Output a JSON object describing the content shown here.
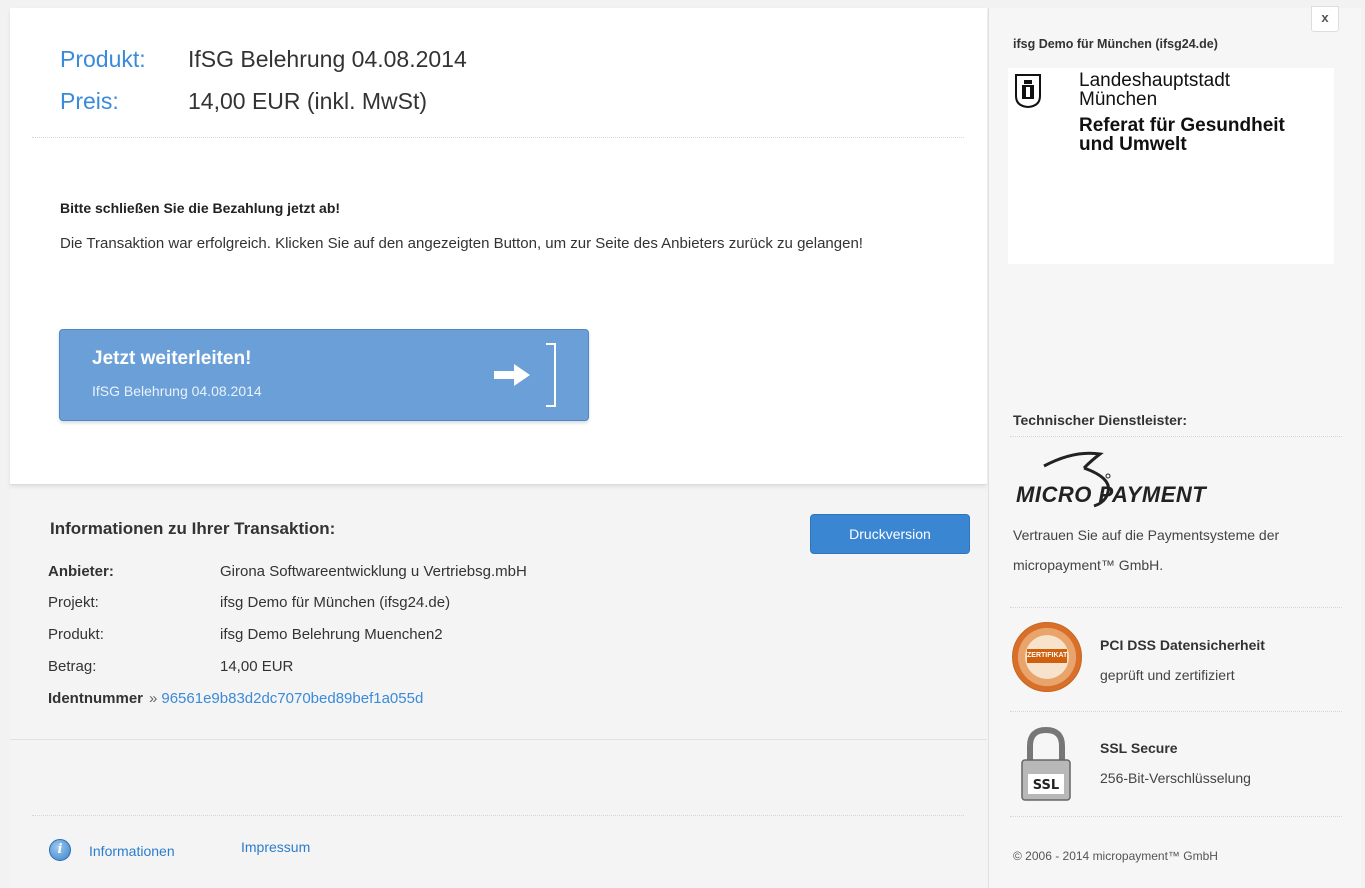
{
  "window": {
    "close_label": "x"
  },
  "product": {
    "product_label": "Produkt:",
    "product_value": "IfSG Belehrung 04.08.2014",
    "price_label": "Preis:",
    "price_value": "14,00 EUR (inkl. MwSt)"
  },
  "message": {
    "title": "Bitte schließen Sie die Bezahlung jetzt ab!",
    "body": "Die Transaktion war erfolgreich. Klicken Sie auf den angezeigten Button, um zur Seite des Anbieters zurück zu gelangen!"
  },
  "forward_button": {
    "title": "Jetzt weiterleiten!",
    "subtitle": "IfSG Belehrung 04.08.2014"
  },
  "transaction": {
    "title": "Informationen zu Ihrer Transaktion:",
    "print_label": "Druckversion",
    "rows": [
      {
        "key": "Anbieter:",
        "value": "Girona Softwareentwicklung u Vertriebsg.mbH"
      },
      {
        "key": "Projekt:",
        "value": "ifsg Demo für München (ifsg24.de)"
      },
      {
        "key": "Produkt:",
        "value": "ifsg Demo Belehrung Muenchen2"
      },
      {
        "key": "Betrag:",
        "value": "14,00 EUR"
      }
    ],
    "ident_label": "Identnummer",
    "ident_sep": "»",
    "ident_value": "96561e9b83d2dc7070bed89bef1a055d"
  },
  "footer": {
    "info_icon": "info-icon",
    "info_link": "Informationen",
    "imprint_link": "Impressum"
  },
  "sidebar": {
    "project_title": "ifsg Demo für München (ifsg24.de)",
    "logo": {
      "city_line1": "Landeshauptstadt",
      "city_line2": "München",
      "ref_line1": "Referat für Gesundheit",
      "ref_line2": "und Umwelt"
    },
    "tech_title": "Technischer Dienstleister:",
    "mp_logo_text": "MICRO PAYMENT",
    "mp_desc": "Vertrauen Sie auf die Paymentsysteme der micropayment™ GmbH.",
    "pci_title": "PCI DSS Datensicherheit",
    "pci_sub": "geprüft und zertifiziert",
    "pci_seal_text": "ZERTIFIKAT",
    "ssl_title": "SSL Secure",
    "ssl_sub": "256-Bit-Verschlüsselung",
    "ssl_lock_text": "SSL",
    "copyright": "© 2006 - 2014 micropayment™ GmbH"
  },
  "colors": {
    "accent_blue": "#3a8ad9",
    "button_blue": "#6a9fd8",
    "print_button": "#3a86d2",
    "seal_orange": "#d86f2b"
  }
}
